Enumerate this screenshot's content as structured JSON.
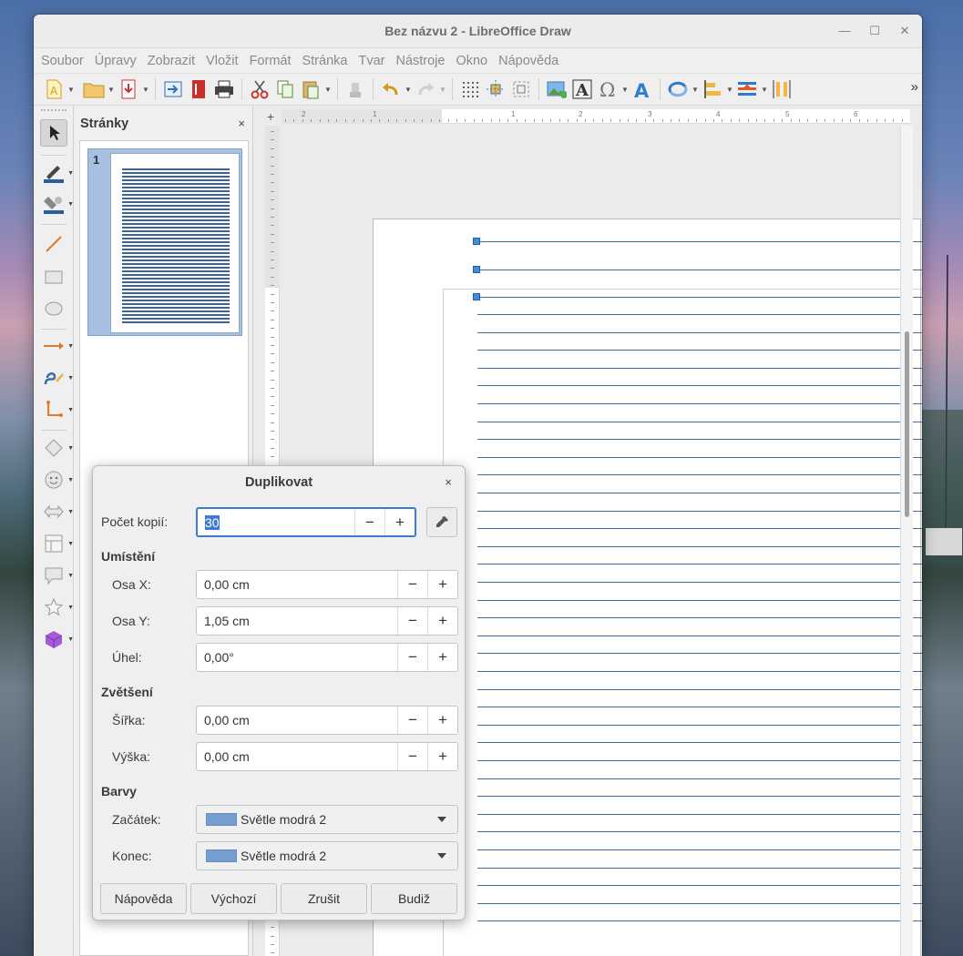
{
  "window": {
    "title": "Bez názvu 2 - LibreOffice Draw"
  },
  "menu": [
    "Soubor",
    "Úpravy",
    "Zobrazit",
    "Vložit",
    "Formát",
    "Stránka",
    "Tvar",
    "Nástroje",
    "Okno",
    "Nápověda"
  ],
  "toolbar": {
    "more_label": "»",
    "icons": [
      "new-document-icon",
      "open-folder-icon",
      "save-icon",
      "export-icon",
      "export-pdf-icon",
      "print-icon",
      "cut-icon",
      "copy-icon",
      "paste-icon",
      "clone-formatting-icon",
      "undo-icon",
      "redo-icon",
      "grid-icon",
      "helplines-icon",
      "snap-icon",
      "insert-image-icon",
      "insert-text-box-icon",
      "special-character-icon",
      "fontwork-icon",
      "transformations-icon",
      "align-icon",
      "arrange-icon",
      "distribute-icon"
    ]
  },
  "pages_panel": {
    "title": "Stránky",
    "close": "×",
    "pages": [
      {
        "number": "1"
      }
    ]
  },
  "ruler": {
    "corner": "+",
    "numbers": [
      "2",
      "1",
      "1",
      "2",
      "3",
      "4",
      "5",
      "6"
    ]
  },
  "dialog": {
    "title": "Duplikovat",
    "close": "×",
    "copies_label": "Počet kopií:",
    "copies_value": "30",
    "placement_title": "Umístění",
    "x_label": "Osa X:",
    "x_value": "0,00 cm",
    "y_label": "Osa Y:",
    "y_value": "1,05 cm",
    "angle_label": "Úhel:",
    "angle_value": "0,00°",
    "enlarge_title": "Zvětšení",
    "width_label": "Šířka:",
    "width_value": "0,00 cm",
    "height_label": "Výška:",
    "height_value": "0,00 cm",
    "colors_title": "Barvy",
    "start_label": "Začátek:",
    "start_value": "Světle modrá 2",
    "end_label": "Konec:",
    "end_value": "Světle modrá 2",
    "swatch_color": "#729fcf",
    "minus": "−",
    "plus": "+",
    "buttons": {
      "help": "Nápověda",
      "defaults": "Výchozí",
      "cancel": "Zrušit",
      "ok": "Budiž"
    }
  }
}
